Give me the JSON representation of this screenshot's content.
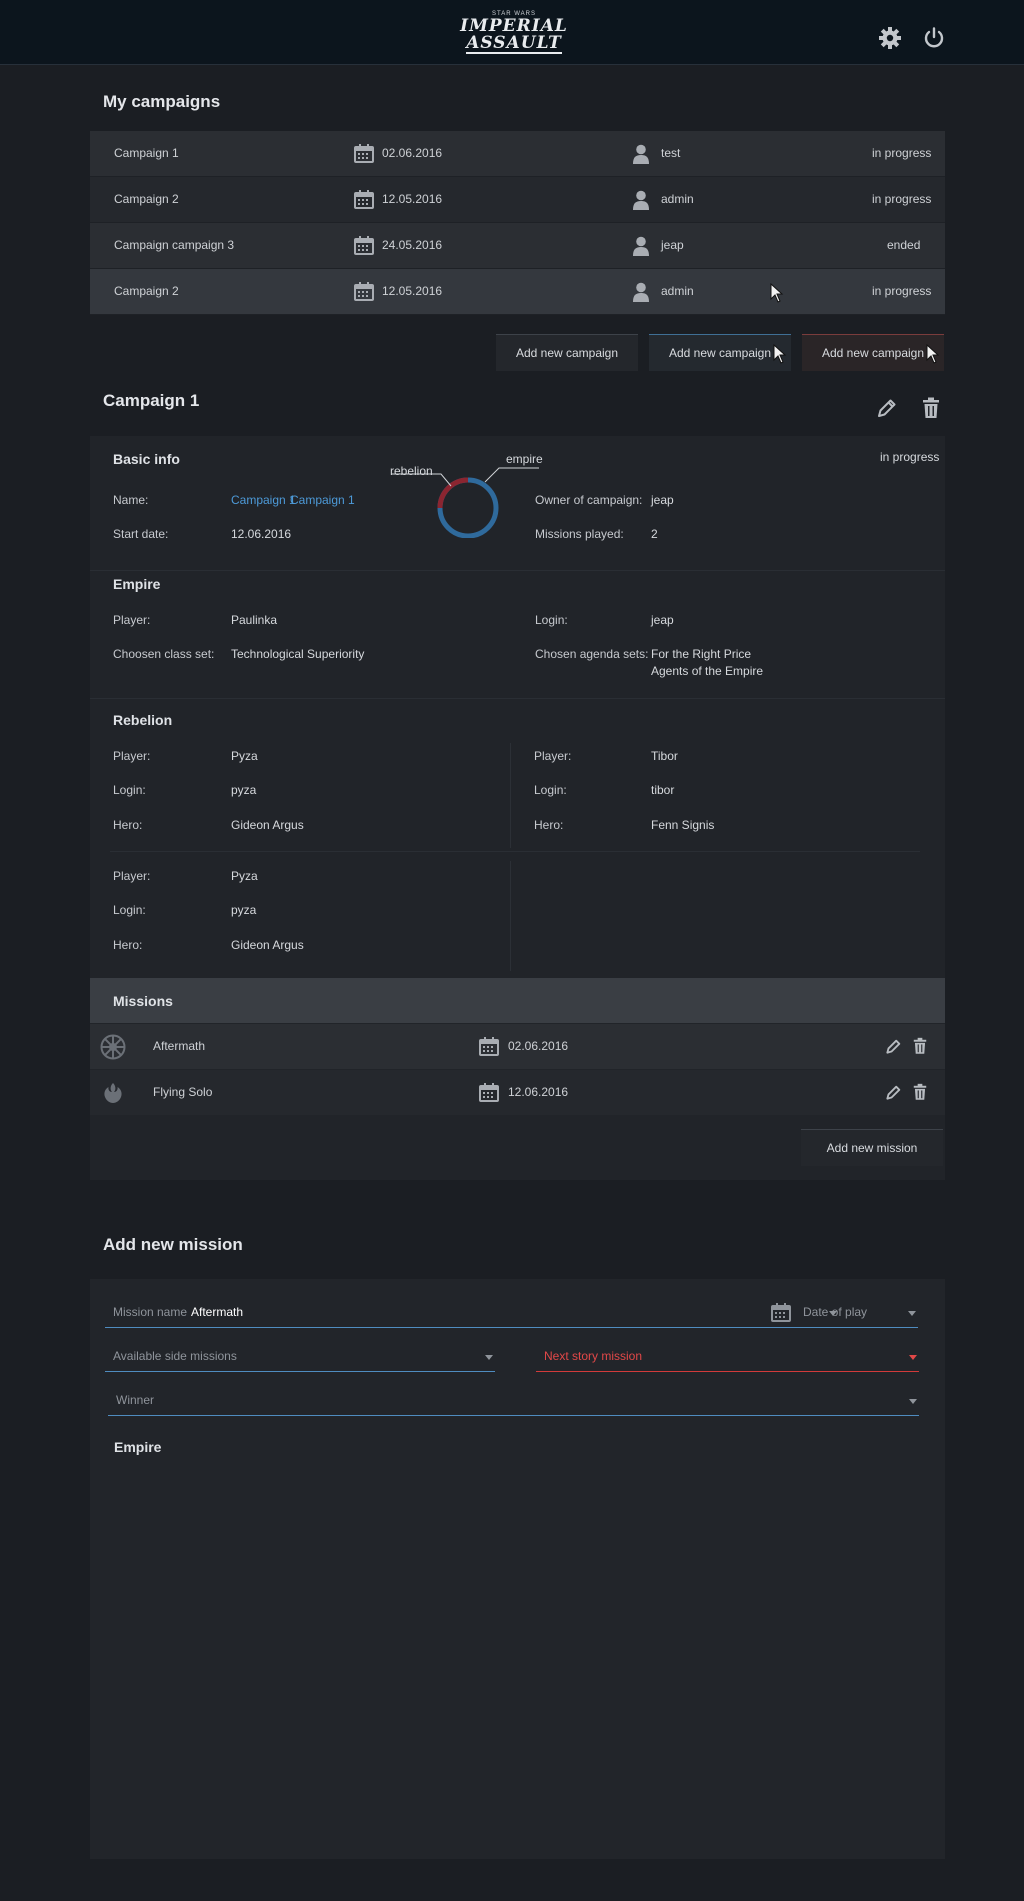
{
  "header": {
    "logo_small": "STAR WARS",
    "logo_line1": "IMPERIAL",
    "logo_line2": "ASSAULT",
    "settings_icon": "gear-icon",
    "power_icon": "power-icon"
  },
  "campaigns": {
    "title": "My campaigns",
    "rows": [
      {
        "name": "Campaign 1",
        "date": "02.06.2016",
        "owner": "test",
        "status": "in progress"
      },
      {
        "name": "Campaign 2",
        "date": "12.05.2016",
        "owner": "admin",
        "status": "in progress"
      },
      {
        "name": "Campaign campaign 3",
        "date": "24.05.2016",
        "owner": "jeap",
        "status": "ended"
      },
      {
        "name": "Campaign 2",
        "date": "12.05.2016",
        "owner": "admin",
        "status": "in progress"
      }
    ],
    "buttons": [
      "Add new campaign",
      "Add new campaign",
      "Add new campaign"
    ]
  },
  "detail": {
    "title": "Campaign 1",
    "basic": {
      "title": "Basic info",
      "status": "in progress",
      "name_label": "Name:",
      "name_values": [
        "Campaign 1",
        "Campaign 1"
      ],
      "start_label": "Start date:",
      "start_value": "12.06.2016",
      "owner_label": "Owner of campaign:",
      "owner_value": "jeap",
      "played_label": "Missions played:",
      "played_value": "2",
      "chart_rebelion": "rebelion",
      "chart_empire": "empire"
    },
    "empire": {
      "title": "Empire",
      "player_label": "Player:",
      "player": "Paulinka",
      "login_label": "Login:",
      "login": "jeap",
      "class_label": "Choosen class set:",
      "class_set": "Technological Superiority",
      "agenda_label": "Chosen agenda sets:",
      "agenda1": "For the Right Price",
      "agenda2": "Agents of the Empire"
    },
    "rebelion": {
      "title": "Rebelion",
      "player_label": "Player:",
      "login_label": "Login:",
      "hero_label": "Hero:",
      "players": [
        {
          "player": "Pyza",
          "login": "pyza",
          "hero": "Gideon Argus"
        },
        {
          "player": "Tibor",
          "login": "tibor",
          "hero": "Fenn Signis"
        },
        {
          "player": "Pyza",
          "login": "pyza",
          "hero": "Gideon Argus"
        }
      ]
    },
    "missions": {
      "title": "Missions",
      "rows": [
        {
          "icon": "empire-emblem-icon",
          "name": "Aftermath",
          "date": "02.06.2016"
        },
        {
          "icon": "rebel-emblem-icon",
          "name": "Flying Solo",
          "date": "12.06.2016"
        }
      ],
      "add_button": "Add new mission"
    }
  },
  "form": {
    "title": "Add new mission",
    "mission_name_label": "Mission name",
    "mission_name_value": "Aftermath",
    "date_placeholder": "Date of play",
    "side_placeholder": "Available side missions",
    "story_placeholder": "Next story mission",
    "winner_placeholder": "Winner",
    "empire_title": "Empire"
  },
  "colors": {
    "background": "#1b1e23",
    "accent_blue": "#4d9ad8",
    "error_red": "#e24848",
    "empire_blue": "#2f6a9c",
    "rebel_red": "#8b2530"
  }
}
